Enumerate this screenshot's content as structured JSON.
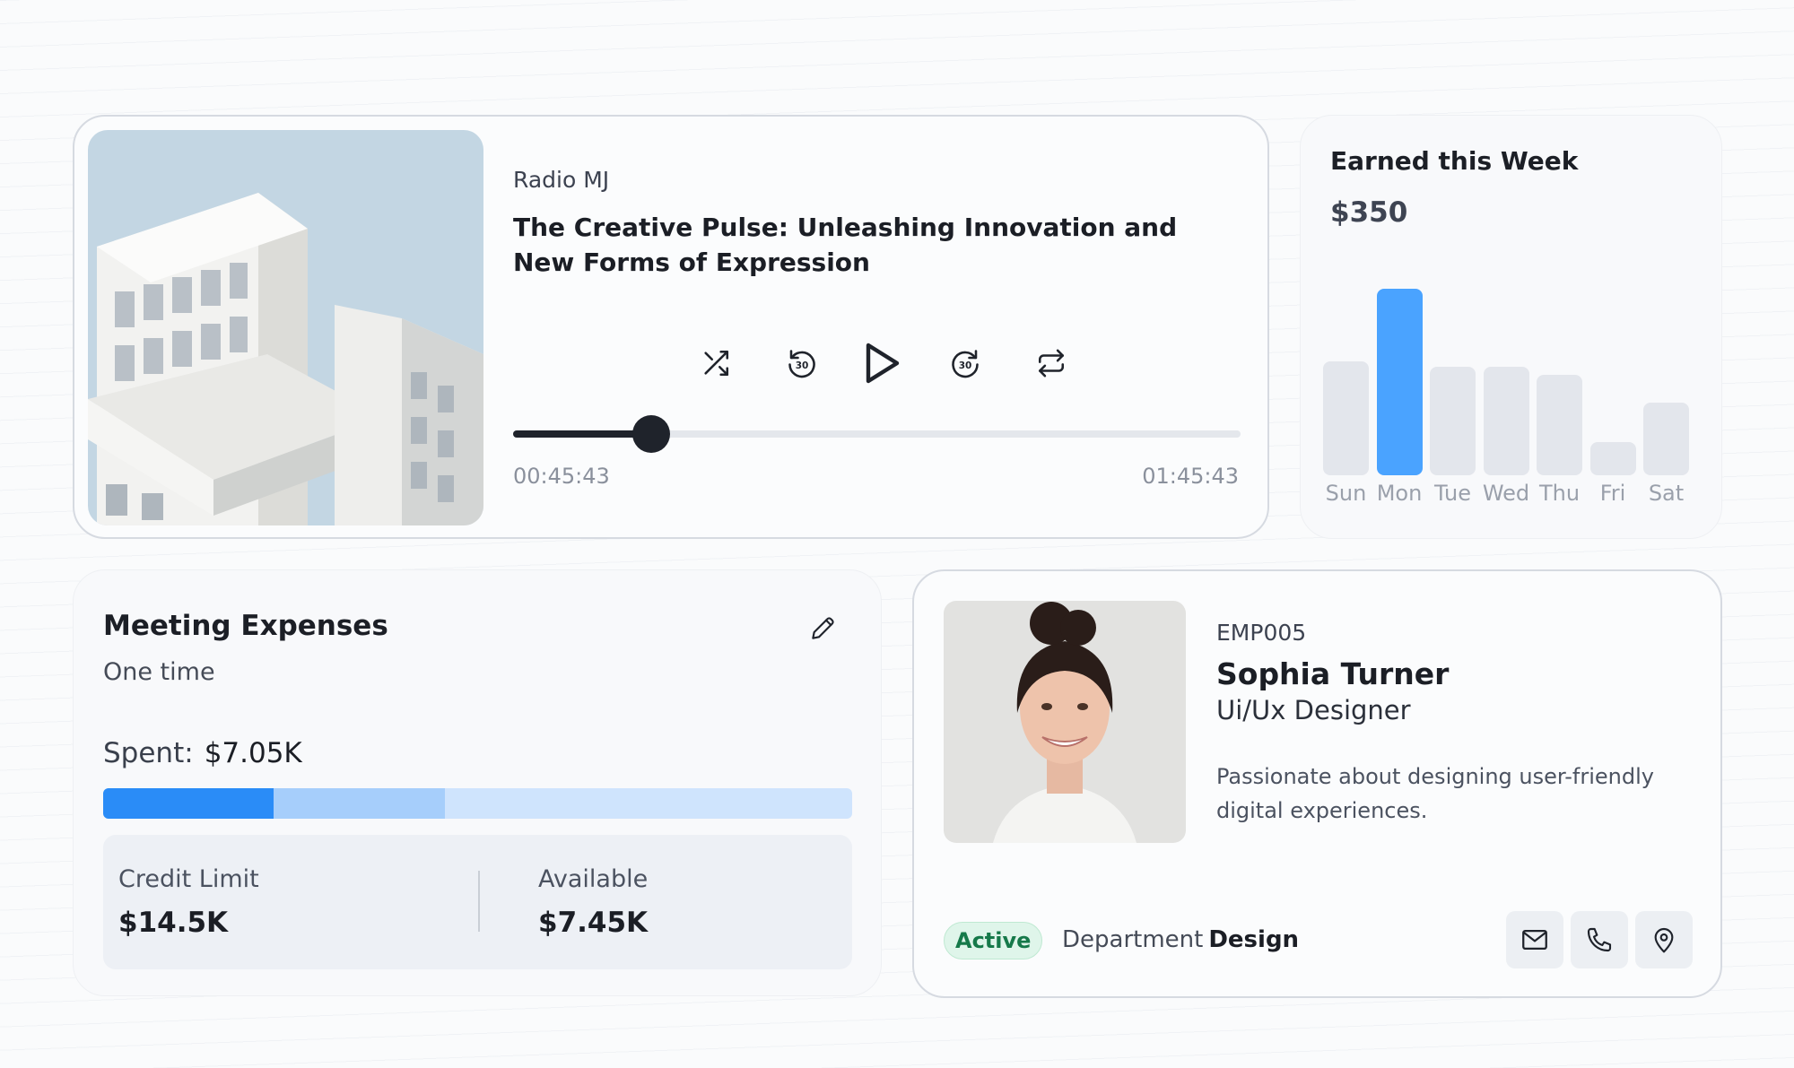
{
  "player": {
    "station": "Radio MJ",
    "episode_title": "The Creative Pulse: Unleashing Innovation and New Forms of Expression",
    "controls": [
      "shuffle-icon",
      "rewind-30-icon",
      "play-icon",
      "forward-30-icon",
      "repeat-icon"
    ],
    "progress_fraction": 0.19,
    "current_time": "00:45:43",
    "total_time": "01:45:43"
  },
  "earnings": {
    "title": "Earned this Week",
    "amount": "$350",
    "accent_color": "#4aa3ff",
    "chart_data": {
      "type": "bar",
      "categories": [
        "Sun",
        "Mon",
        "Tue",
        "Wed",
        "Thu",
        "Fri",
        "Sat"
      ],
      "values": [
        0.61,
        1.0,
        0.58,
        0.58,
        0.54,
        0.18,
        0.39
      ],
      "highlighted": "Mon"
    }
  },
  "expenses": {
    "title": "Meeting Expenses",
    "subtitle": "One time",
    "spent_label": "Spent:",
    "spent_value": "$7.05K",
    "progress_segments": [
      {
        "fraction": 0.228,
        "color": "#2a8cf7"
      },
      {
        "fraction": 0.228,
        "color": "#a6cefb"
      }
    ],
    "credit_limit_label": "Credit Limit",
    "credit_limit_value": "$14.5K",
    "available_label": "Available",
    "available_value": "$7.45K"
  },
  "profile": {
    "employee_id": "EMP005",
    "name": "Sophia Turner",
    "role": "Ui/Ux Designer",
    "bio": "Passionate about designing user-friendly digital experiences.",
    "status": "Active",
    "department_label": "Department",
    "department_value": "Design",
    "actions": [
      "mail-icon",
      "phone-icon",
      "location-pin-icon"
    ]
  }
}
